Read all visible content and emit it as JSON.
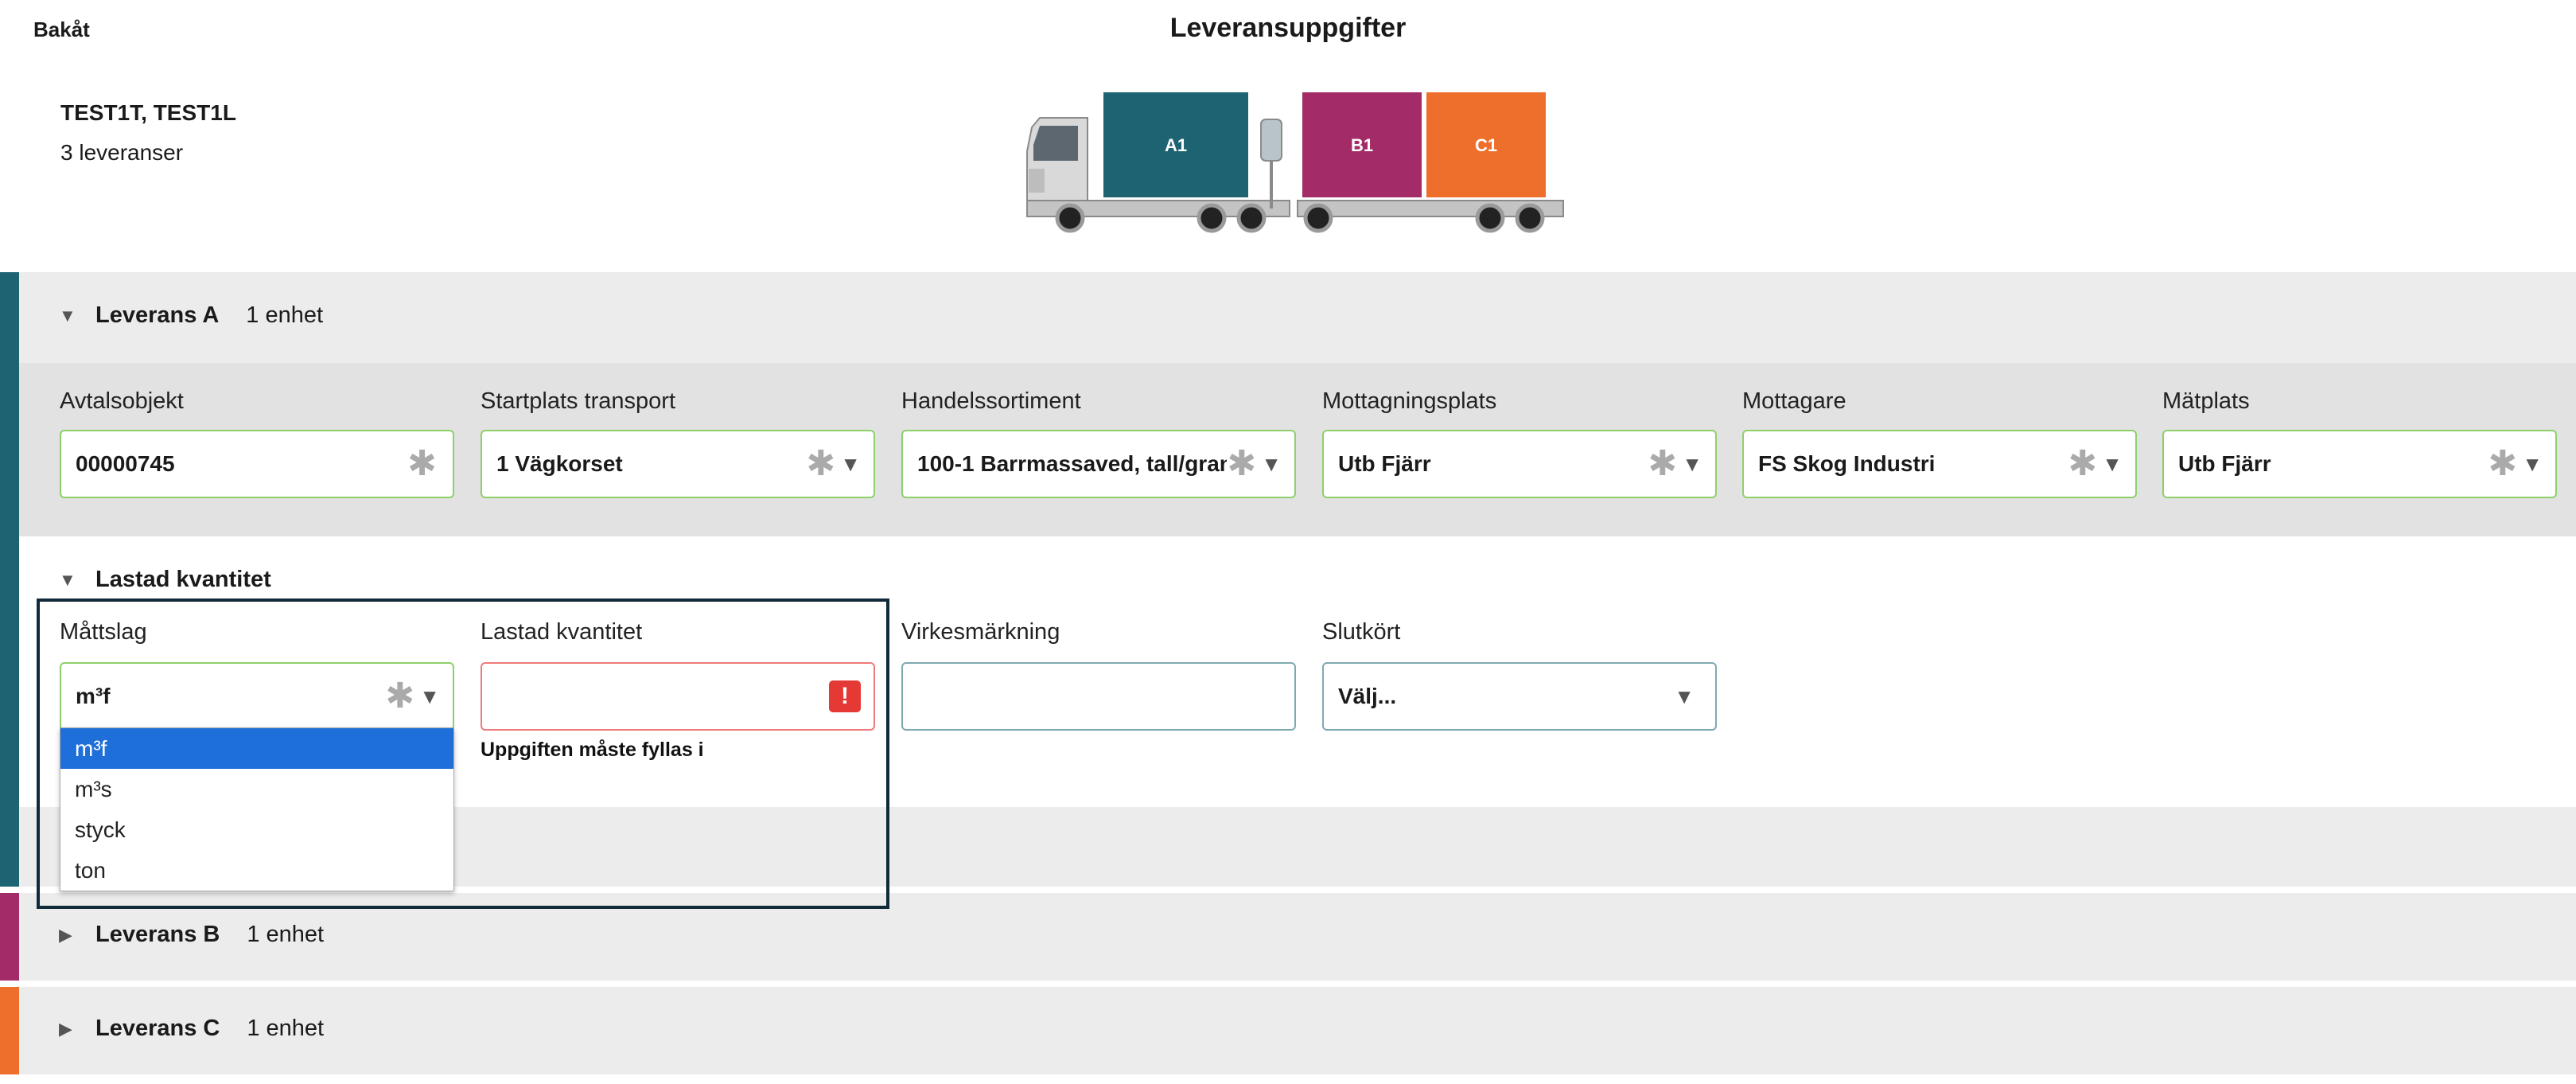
{
  "header": {
    "back_label": "Bakåt",
    "title": "Leveransuppgifter",
    "trip_title": "TEST1T, TEST1L",
    "trip_subtitle": "3 leveranser"
  },
  "truck": {
    "containers": [
      {
        "label": "A1",
        "color": "#1e6372"
      },
      {
        "label": "B1",
        "color": "#a32b67"
      },
      {
        "label": "C1",
        "color": "#ee6f2b"
      }
    ]
  },
  "deliveries": [
    {
      "name": "Leverans A",
      "units": "1 enhet",
      "color": "#1e6372",
      "expanded": true
    },
    {
      "name": "Leverans B",
      "units": "1 enhet",
      "color": "#a32b67",
      "expanded": false
    },
    {
      "name": "Leverans C",
      "units": "1 enhet",
      "color": "#ee6f2b",
      "expanded": false
    }
  ],
  "fields": [
    {
      "label": "Avtalsobjekt",
      "value": "00000745"
    },
    {
      "label": "Startplats transport",
      "value": "1 Vägkorset"
    },
    {
      "label": "Handelssortiment",
      "value": "100-1 Barrmassaved, tall/gran"
    },
    {
      "label": "Mottagningsplats",
      "value": "Utb Fjärr"
    },
    {
      "label": "Mottagare",
      "value": "FS Skog Industri"
    },
    {
      "label": "Mätplats",
      "value": "Utb Fjärr"
    }
  ],
  "quantity": {
    "section_title": "Lastad kvantitet",
    "measure_label": "Måttslag",
    "measure_value": "m³f",
    "measure_options": [
      "m³f",
      "m³s",
      "styck",
      "ton"
    ],
    "quantity_label": "Lastad kvantitet",
    "quantity_value": "",
    "error_badge": "!",
    "error_message": "Uppgiften måste fyllas i",
    "marking_label": "Virkesmärkning",
    "marking_value": "",
    "final_label": "Slutkört",
    "final_value": "Välj..."
  }
}
